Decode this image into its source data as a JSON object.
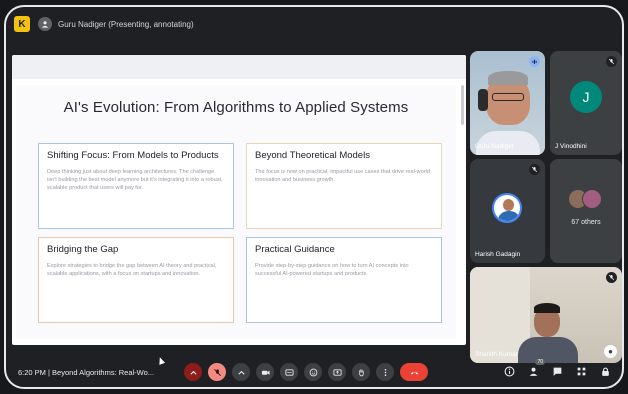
{
  "topbar": {
    "presenter_label": "Guru Nadiger (Presenting, annotating)"
  },
  "slide": {
    "title": "AI's Evolution: From Algorithms to Applied Systems",
    "cards": [
      {
        "heading": "Shifting Focus: From Models to Products",
        "body": "Deep thinking just about deep learning architectures. The challenge isn't building the best model anymore but it's integrating it into a robust, scalable product that users will pay for."
      },
      {
        "heading": "Beyond Theoretical Models",
        "body": "The focus is now on practical, impactful use cases that drive real-world innovation and business growth."
      },
      {
        "heading": "Bridging the Gap",
        "body": "Explore strategies to bridge the gap between AI theory and practical, scalable applications, with a focus on startups and innovation."
      },
      {
        "heading": "Practical Guidance",
        "body": "Provide step-by-step guidance on how to turn AI concepts into successful AI-powered startups and products."
      }
    ]
  },
  "participants": {
    "tile1": {
      "name": "Guru Nadiger"
    },
    "tile2": {
      "name": "J Vinodhini",
      "initial": "J"
    },
    "tile3": {
      "name": "Harish Gadagin"
    },
    "tile4": {
      "others_label": "67 others"
    },
    "tile5": {
      "name": "Shanith Kumar"
    }
  },
  "bottombar": {
    "time_title": "6:20 PM  |  Beyond Algorithms: Real-Wo...",
    "participant_count": "70"
  },
  "colors": {
    "end_call": "#ea4335",
    "mic_off": "#f28b82",
    "accent": "#8ab4f8"
  }
}
